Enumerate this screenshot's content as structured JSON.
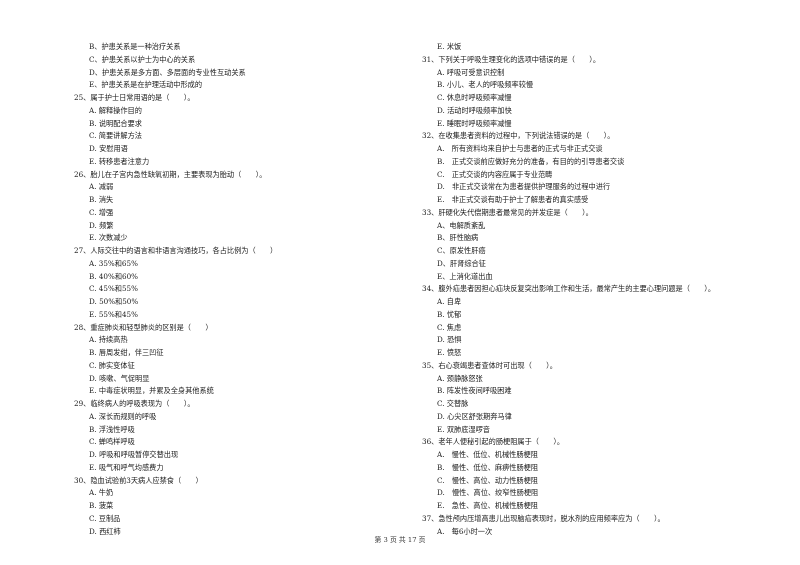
{
  "left_column": [
    {
      "type": "opt",
      "text": "B、护患关系是一种治疗关系"
    },
    {
      "type": "opt",
      "text": "C、护患关系以护士为中心的关系"
    },
    {
      "type": "opt",
      "text": "D、护患关系是多方面、多层面的专业性互动关系"
    },
    {
      "type": "opt",
      "text": "E、护患关系是在护理活动中形成的"
    },
    {
      "type": "q",
      "text": "25、属于护士日常用语的是（　　）。"
    },
    {
      "type": "opt",
      "text": "A. 解释操作目的"
    },
    {
      "type": "opt",
      "text": "B. 说明配合要求"
    },
    {
      "type": "opt",
      "text": "C. 简要讲解方法"
    },
    {
      "type": "opt",
      "text": "D. 安慰用语"
    },
    {
      "type": "opt",
      "text": "E. 转移患者注意力"
    },
    {
      "type": "q",
      "text": "26、胎儿在子宫内急性缺氧初期，主要表现为胎动（　　）。"
    },
    {
      "type": "opt",
      "text": "A. 减弱"
    },
    {
      "type": "opt",
      "text": "B. 消失"
    },
    {
      "type": "opt",
      "text": "C. 增强"
    },
    {
      "type": "opt",
      "text": "D. 频繁"
    },
    {
      "type": "opt",
      "text": "E. 次数减少"
    },
    {
      "type": "q",
      "text": "27、人际交往中的语言和非语言沟通技巧，各占比例为（　　）"
    },
    {
      "type": "opt",
      "text": "A. 35%和65%"
    },
    {
      "type": "opt",
      "text": "B. 40%和60%"
    },
    {
      "type": "opt",
      "text": "C. 45%和55%"
    },
    {
      "type": "opt",
      "text": "D. 50%和50%"
    },
    {
      "type": "opt",
      "text": "E. 55%和45%"
    },
    {
      "type": "q",
      "text": "28、重症肺炎和轻型肺炎的区别是（　　）"
    },
    {
      "type": "opt",
      "text": "A. 持续高热"
    },
    {
      "type": "opt",
      "text": "B. 唇周发绀，伴三凹征"
    },
    {
      "type": "opt",
      "text": "C. 肺实变体征"
    },
    {
      "type": "opt",
      "text": "D. 咳嗽、气促明显"
    },
    {
      "type": "opt",
      "text": "E. 中毒症状明显，并累及全身其他系统"
    },
    {
      "type": "q",
      "text": "29、临终病人的呼吸表现为（　　）。"
    },
    {
      "type": "opt",
      "text": "A. 深长而规则的呼吸"
    },
    {
      "type": "opt",
      "text": "B. 浮浅性呼吸"
    },
    {
      "type": "opt",
      "text": "C. 蝉鸣样呼吸"
    },
    {
      "type": "opt",
      "text": "D. 呼吸和呼吸暂停交替出现"
    },
    {
      "type": "opt",
      "text": "E. 吸气和呼气均感费力"
    },
    {
      "type": "q",
      "text": "30、隐血试验前3天病人应禁食（　　）"
    },
    {
      "type": "opt",
      "text": "A. 牛奶"
    },
    {
      "type": "opt",
      "text": "B. 菠菜"
    },
    {
      "type": "opt",
      "text": "C. 豆制品"
    },
    {
      "type": "opt",
      "text": "D. 西红柿"
    }
  ],
  "right_column": [
    {
      "type": "opt",
      "text": "E. 米饭"
    },
    {
      "type": "q",
      "text": "31、下列关于呼吸生理变化的选项中错误的是（　　）。"
    },
    {
      "type": "opt",
      "text": "A. 呼吸可受意识控制"
    },
    {
      "type": "opt",
      "text": "B. 小儿、老人的呼吸频率较慢"
    },
    {
      "type": "opt",
      "text": "C. 休息时呼吸频率减慢"
    },
    {
      "type": "opt",
      "text": "D. 活动时呼吸频率加快"
    },
    {
      "type": "opt",
      "text": "E. 睡眠时呼吸频率减慢"
    },
    {
      "type": "q",
      "text": "32、在收集患者资料的过程中，下列说法错误的是（　　）。"
    },
    {
      "type": "opt",
      "text": "A.　所有资料均来自护士与患者的正式与非正式交谈"
    },
    {
      "type": "opt",
      "text": "B.　正式交谈前应做好充分的准备，有目的的引导患者交谈"
    },
    {
      "type": "opt",
      "text": "C.　正式交谈的内容应属于专业范畴"
    },
    {
      "type": "opt",
      "text": "D.　非正式交谈常在为患者提供护理服务的过程中进行"
    },
    {
      "type": "opt",
      "text": "E.　非正式交谈有助于护士了解患者的真实感受"
    },
    {
      "type": "q",
      "text": "33、肝硬化失代偿期患者最常见的并发症是（　　）。"
    },
    {
      "type": "opt",
      "text": "A、电解质紊乱"
    },
    {
      "type": "opt",
      "text": "B、肝性脑病"
    },
    {
      "type": "opt",
      "text": "C、原发性肝癌"
    },
    {
      "type": "opt",
      "text": "D、肝肾综合征"
    },
    {
      "type": "opt",
      "text": "E、上消化道出血"
    },
    {
      "type": "q",
      "text": "34、腹外疝患者因担心疝块反复突出影响工作和生活，最常产生的主要心理问题是（　　）。"
    },
    {
      "type": "opt",
      "text": "A. 自卑"
    },
    {
      "type": "opt",
      "text": "B. 忧郁"
    },
    {
      "type": "opt",
      "text": "C. 焦虑"
    },
    {
      "type": "opt",
      "text": "D. 恐惧"
    },
    {
      "type": "opt",
      "text": "E. 愤怒"
    },
    {
      "type": "q",
      "text": "35、右心衰竭患者查体时可出现（　　）。"
    },
    {
      "type": "opt",
      "text": "A. 颈静脉怒张"
    },
    {
      "type": "opt",
      "text": "B. 阵发性夜间呼吸困难"
    },
    {
      "type": "opt",
      "text": "C. 交替脉"
    },
    {
      "type": "opt",
      "text": "D. 心尖区舒张期奔马律"
    },
    {
      "type": "opt",
      "text": "E. 双肺底湿啰音"
    },
    {
      "type": "q",
      "text": "36、老年人便秘引起的肠梗阻属于（　　）。"
    },
    {
      "type": "opt",
      "text": "A.　慢性、低位、机械性肠梗阻"
    },
    {
      "type": "opt",
      "text": "B.　慢性、低位、麻痹性肠梗阻"
    },
    {
      "type": "opt",
      "text": "C.　慢性、高位、动力性肠梗阻"
    },
    {
      "type": "opt",
      "text": "D.　慢性、高位、绞窄性肠梗阻"
    },
    {
      "type": "opt",
      "text": "E.　急性、高位、机械性肠梗阻"
    },
    {
      "type": "q",
      "text": "37、急性颅内压增高患儿出现脑疝表现时，脱水剂的应用频率应为（　　）。"
    },
    {
      "type": "opt",
      "text": "A.　每6小时一次"
    }
  ],
  "footer": {
    "page_label": "第 3 页 共 17 页"
  }
}
